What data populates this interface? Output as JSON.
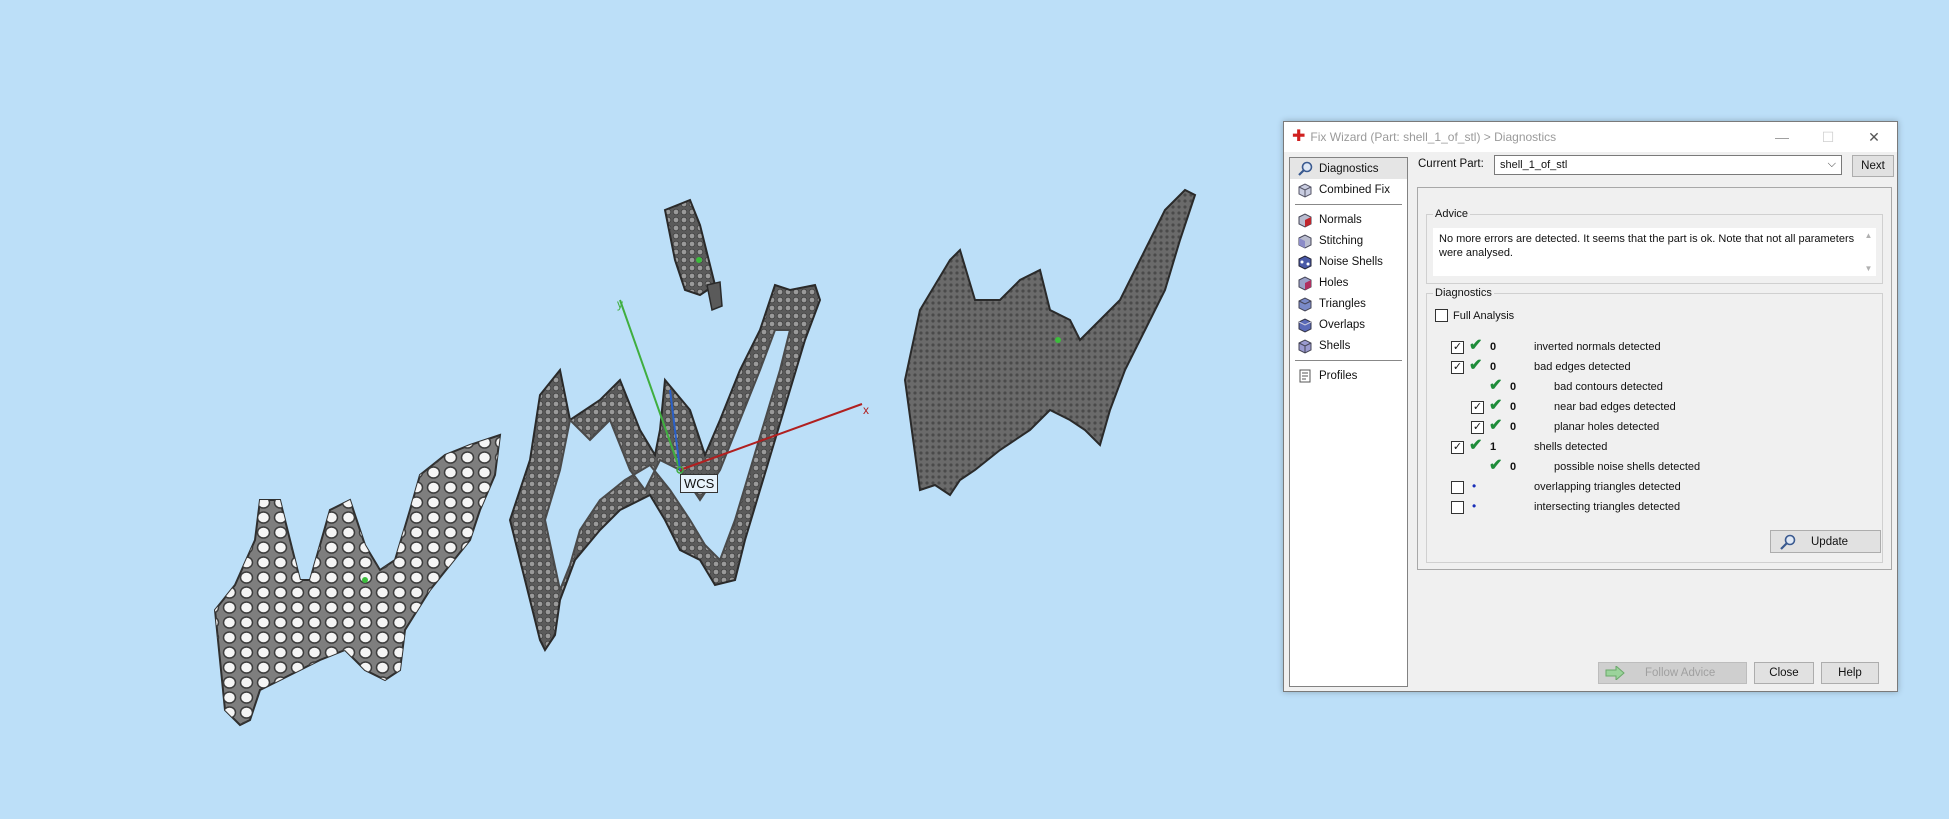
{
  "viewport": {
    "wcs_label": "WCS",
    "axis_x": "x",
    "axis_y": "y"
  },
  "dialog": {
    "title": "Fix Wizard (Part: shell_1_of_stl) > Diagnostics",
    "window_controls": {
      "minimize": "—",
      "maximize": "☐",
      "close": "✕"
    },
    "nav": {
      "top_items": [
        {
          "label": "Diagnostics",
          "icon": "magnifier-icon",
          "selected": true
        },
        {
          "label": "Combined Fix",
          "icon": "cube-icon"
        }
      ],
      "fix_items": [
        {
          "label": "Normals",
          "icon": "normals-cube-icon",
          "color": "#c0262d"
        },
        {
          "label": "Stitching",
          "icon": "stitching-cube-icon",
          "color": "#8c8cc8"
        },
        {
          "label": "Noise Shells",
          "icon": "noise-shells-icon",
          "color": "#4a5aa8"
        },
        {
          "label": "Holes",
          "icon": "holes-cube-icon",
          "color": "#b03060"
        },
        {
          "label": "Triangles",
          "icon": "triangles-cube-icon",
          "color": "#7a8ac8"
        },
        {
          "label": "Overlaps",
          "icon": "overlaps-cube-icon",
          "color": "#5a6ab8"
        },
        {
          "label": "Shells",
          "icon": "shells-cube-icon",
          "color": "#9a9ad0"
        }
      ],
      "bottom_items": [
        {
          "label": "Profiles",
          "icon": "profiles-icon"
        }
      ]
    },
    "current_part": {
      "label": "Current Part:",
      "value": "shell_1_of_stl",
      "next_label": "Next"
    },
    "advice": {
      "title": "Advice",
      "text": "No more errors are detected. It seems that the part is ok. Note that not all parameters were analysed."
    },
    "diagnostics": {
      "title": "Diagnostics",
      "full_analysis_label": "Full Analysis",
      "full_analysis_checked": false,
      "rows": [
        {
          "checked": true,
          "has_checkbox": true,
          "status": "ok",
          "count": "0",
          "label": "inverted normals detected",
          "level": 0
        },
        {
          "checked": true,
          "has_checkbox": true,
          "status": "ok",
          "count": "0",
          "label": "bad edges detected",
          "level": 0
        },
        {
          "checked": false,
          "has_checkbox": false,
          "status": "ok",
          "count": "0",
          "label": "bad contours detected",
          "level": 1
        },
        {
          "checked": true,
          "has_checkbox": true,
          "status": "ok",
          "count": "0",
          "label": "near bad edges detected",
          "level": 1
        },
        {
          "checked": true,
          "has_checkbox": true,
          "status": "ok",
          "count": "0",
          "label": "planar holes detected",
          "level": 1
        },
        {
          "checked": true,
          "has_checkbox": true,
          "status": "ok",
          "count": "1",
          "label": "shells detected",
          "level": 0
        },
        {
          "checked": false,
          "has_checkbox": false,
          "status": "ok",
          "count": "0",
          "label": "possible noise shells detected",
          "level": 1
        },
        {
          "checked": false,
          "has_checkbox": true,
          "status": "none",
          "count": "",
          "label": "overlapping triangles detected",
          "level": 0
        },
        {
          "checked": false,
          "has_checkbox": true,
          "status": "none",
          "count": "",
          "label": "intersecting triangles detected",
          "level": 0
        }
      ],
      "update_label": "Update"
    },
    "buttons": {
      "follow_advice": "Follow Advice",
      "close": "Close",
      "help": "Help"
    },
    "colors": {
      "check_green": "#1f8c3a",
      "dot_blue": "#1a2fb8",
      "app_icon_red": "#d0201f",
      "viewport_bg": "#bcdff8"
    }
  }
}
